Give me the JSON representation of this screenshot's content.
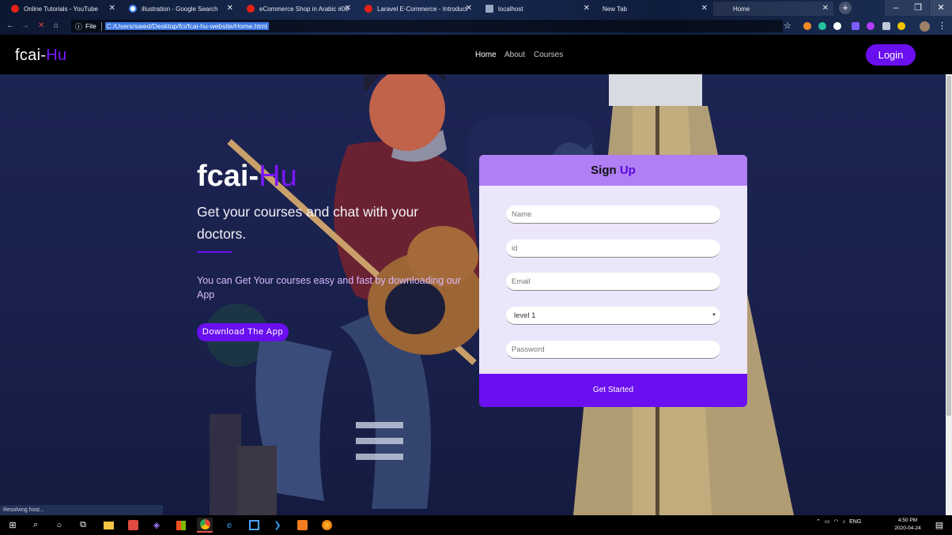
{
  "browser": {
    "tabs": [
      {
        "title": "Online Tutorials - YouTube",
        "favicon_color": "#e62117"
      },
      {
        "title": "illustration - Google Search",
        "favicon_color": "#ffffff"
      },
      {
        "title": "eCommerce Shop in Arabic #00",
        "favicon_color": "#e62117"
      },
      {
        "title": "Laravel E-Commerce - Introduct",
        "favicon_color": "#e62117"
      },
      {
        "title": "localhost",
        "favicon_color": "#9aa7c2"
      },
      {
        "title": "New Tab",
        "favicon_color": ""
      },
      {
        "title": "Home",
        "favicon_color": ""
      }
    ],
    "address_prefix": "File",
    "url": "C:/Users/saied/Desktop/fci/fcai-hu-website/Home.html",
    "status_text": "Resolving host..."
  },
  "nav": {
    "logo_main": "fcai-",
    "logo_accent": "Hu",
    "links": [
      "Home",
      "About",
      "Courses"
    ],
    "login_label": "Login"
  },
  "hero": {
    "title_main": "fcai-",
    "title_accent": "Hu",
    "subtitle": "Get your courses and chat with your doctors.",
    "description": "You can Get Your courses easy and fast by downloading our App",
    "download_label": "Download The App"
  },
  "signup": {
    "title_main": "Sign ",
    "title_accent": "Up",
    "name_placeholder": "Name",
    "id_placeholder": "id",
    "email_placeholder": "Email",
    "level_selected": "level 1",
    "password_placeholder": "Password",
    "submit_label": "Get Started"
  },
  "taskbar": {
    "language": "ENG",
    "time": "4:50 PM",
    "date": "2020-04-24"
  },
  "colors": {
    "accent": "#6a0ff0",
    "hero_bg": "#1b2250",
    "card_header": "#b07ef5",
    "card_body": "#ece6fb"
  }
}
